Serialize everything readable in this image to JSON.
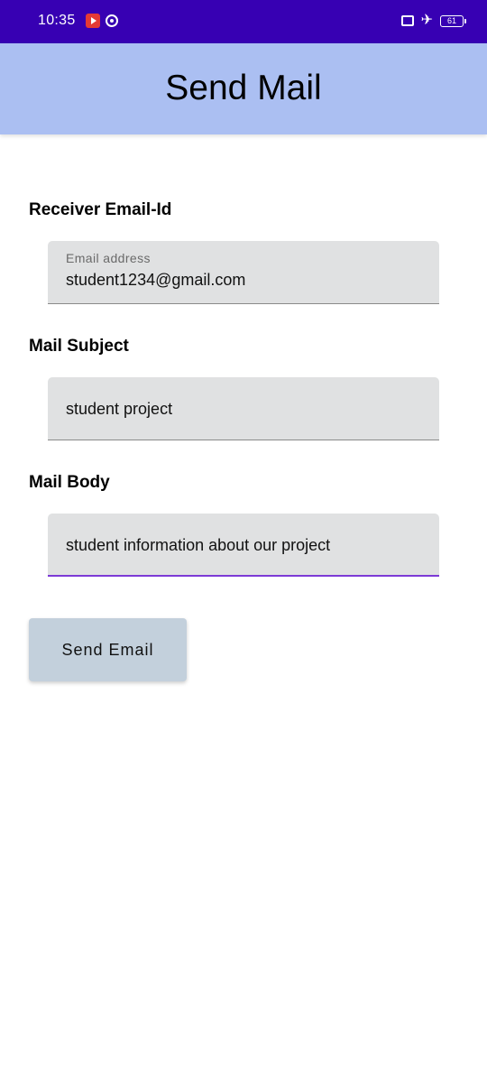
{
  "status_bar": {
    "time": "10:35",
    "battery": "61",
    "left_icons": [
      "youtube-icon",
      "viber-icon"
    ],
    "right_icons": [
      "sim-icon",
      "airplane-icon",
      "battery-icon"
    ]
  },
  "app_bar": {
    "title": "Send Mail",
    "background": "#abbff2"
  },
  "form": {
    "receiver": {
      "label": "Receiver Email-Id",
      "floating_label": "Email address",
      "value": "student1234@gmail.com"
    },
    "subject": {
      "label": "Mail Subject",
      "value": "student project"
    },
    "body": {
      "label": "Mail Body",
      "value": "student information about our project"
    },
    "send_label": "Send Email"
  },
  "colors": {
    "status_bar": "#3700b3",
    "accent": "#7c3ad6",
    "field_bg": "#e0e1e2",
    "button_bg": "#c3d0dc"
  }
}
